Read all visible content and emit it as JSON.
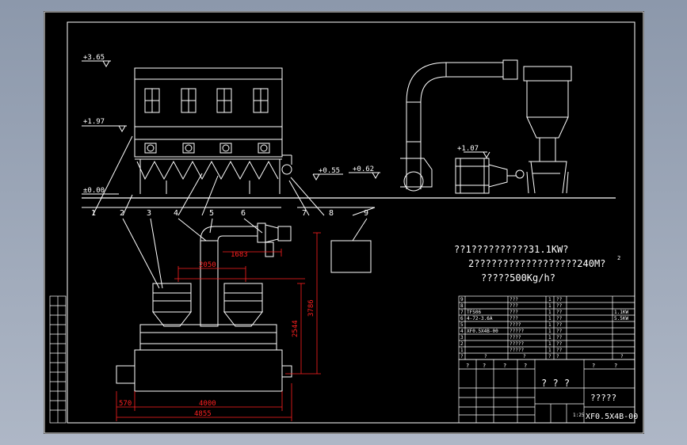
{
  "levels": {
    "top": "+3.65",
    "mid": "+1.97",
    "base": "±0.00",
    "feeder": "+0.55",
    "duct": "+0.62",
    "fan": "+1.07"
  },
  "callouts": [
    "1",
    "2",
    "3",
    "4",
    "5",
    "6",
    "7",
    "8",
    "9"
  ],
  "dimensions": {
    "duct_horizontal": "1683",
    "inner_width": "2050",
    "height_total": "3786",
    "height_hopper": "2544",
    "offset_left": "570",
    "bed_length": "4000",
    "overall_length": "4855"
  },
  "notes": {
    "line1": "??1??????????31.1KW?",
    "line2": "2??????????????????240M?",
    "line2_sup": "2",
    "line3": "?????500Kg/h?"
  },
  "parts_list": {
    "rows": [
      {
        "no": "9",
        "code": "",
        "name": "???",
        "qty": "1",
        "unit": "??",
        "note": ""
      },
      {
        "no": "8",
        "code": "",
        "name": "???",
        "qty": "1",
        "unit": "??",
        "note": ""
      },
      {
        "no": "7",
        "code": "TFS06",
        "name": "???",
        "qty": "1",
        "unit": "??",
        "note": "1.1KW"
      },
      {
        "no": "6",
        "code": "4-72-3.6A",
        "name": "???",
        "qty": "1",
        "unit": "??",
        "note": "5.5KW"
      },
      {
        "no": "5",
        "code": "",
        "name": "????",
        "qty": "1",
        "unit": "??",
        "note": ""
      },
      {
        "no": "4",
        "code": "XF0.5X4B-00",
        "name": "?????",
        "qty": "1",
        "unit": "??",
        "note": ""
      },
      {
        "no": "3",
        "code": "",
        "name": "????",
        "qty": "1",
        "unit": "??",
        "note": ""
      },
      {
        "no": "2",
        "code": "",
        "name": "?????",
        "qty": "1",
        "unit": "??",
        "note": ""
      },
      {
        "no": "1",
        "code": "",
        "name": "?????",
        "qty": "1",
        "unit": "??",
        "note": ""
      }
    ],
    "header": [
      "?",
      "?",
      "?",
      "?",
      "?",
      "?"
    ]
  },
  "title_block": {
    "drawing_title": "? ? ?",
    "company": "?????",
    "drawing_number": "XF0.5X4B-00",
    "scale": "1:25",
    "small_labels": [
      "?",
      "?",
      "?",
      "?",
      "?",
      "?"
    ]
  },
  "colors": {
    "background": "#000000",
    "line": "#ffffff",
    "dimension": "#ff2020",
    "frame": "#ffffff"
  }
}
